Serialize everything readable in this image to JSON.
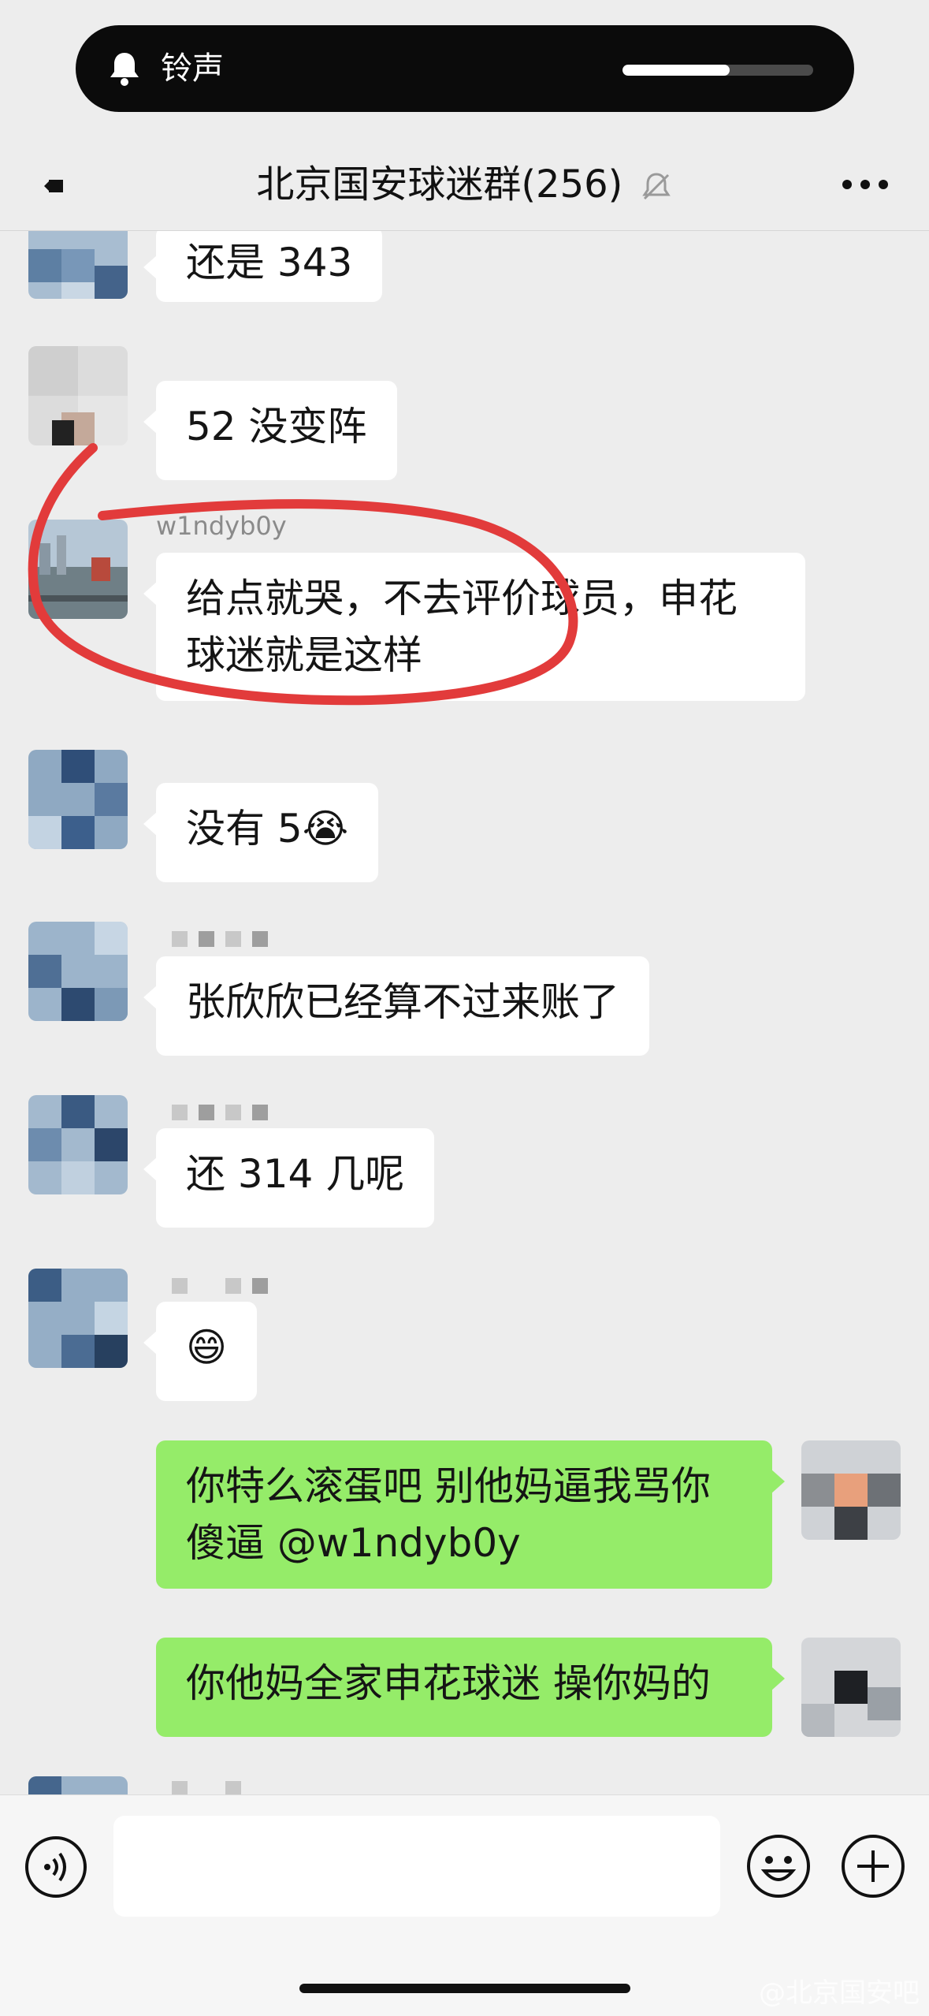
{
  "ringer": {
    "label": "铃声",
    "volume": 0.56
  },
  "header": {
    "title": "北京国安球迷群(256)"
  },
  "messages": [
    {
      "text": "还是 343"
    },
    {
      "text": "52 没变阵"
    },
    {
      "sender": "w1ndyb0y",
      "text": "给点就哭，不去评价球员，申花球迷就是这样"
    },
    {
      "text": "没有 5😭"
    },
    {
      "text": "张欣欣已经算不过来账了"
    },
    {
      "text": "还 314 几呢"
    },
    {
      "text": "😄"
    },
    {
      "text": "你特么滚蛋吧 别他妈逼我骂你傻逼 @w1ndyb0y"
    },
    {
      "text": "你他妈全家申花球迷 操你妈的"
    }
  ],
  "watermark": "@北京国安吧",
  "colors": {
    "bubble_self": "#95ec69",
    "bubble_other": "#ffffff",
    "annotation": "#e23b3b"
  }
}
